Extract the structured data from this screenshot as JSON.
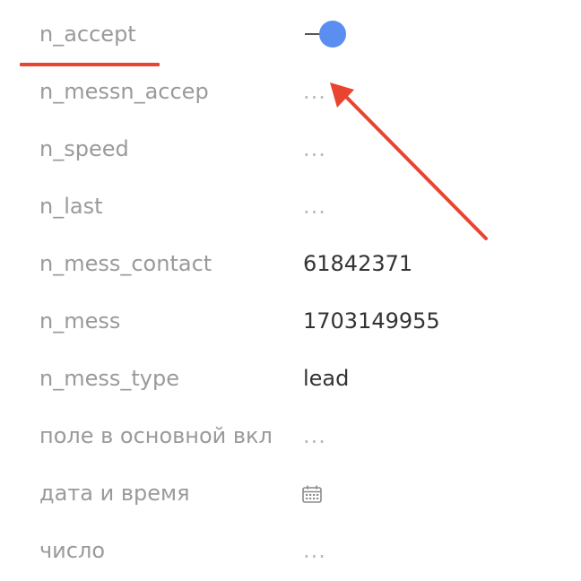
{
  "fields": [
    {
      "label": "n_accept",
      "kind": "toggle",
      "value": ""
    },
    {
      "label": "n_messn_accep",
      "kind": "empty",
      "value": "..."
    },
    {
      "label": "n_speed",
      "kind": "empty",
      "value": "..."
    },
    {
      "label": "n_last",
      "kind": "empty",
      "value": "..."
    },
    {
      "label": "n_mess_contact",
      "kind": "text",
      "value": "61842371"
    },
    {
      "label": "n_mess",
      "kind": "text",
      "value": "1703149955"
    },
    {
      "label": "n_mess_type",
      "kind": "text",
      "value": "lead"
    },
    {
      "label": "поле в основной вкл",
      "kind": "empty",
      "value": "..."
    },
    {
      "label": "дата и время",
      "kind": "date",
      "value": ""
    },
    {
      "label": "число",
      "kind": "empty",
      "value": "..."
    }
  ],
  "colors": {
    "label": "#9a9a9a",
    "value": "#333333",
    "placeholder": "#b8b8b8",
    "toggle_knob": "#5a8ef0",
    "annotation": "#e8442f"
  },
  "icons": {
    "date_field": "calendar-icon"
  },
  "annotations": {
    "highlighted_field": "n_accept",
    "arrow_target": "n_messn_accep"
  }
}
